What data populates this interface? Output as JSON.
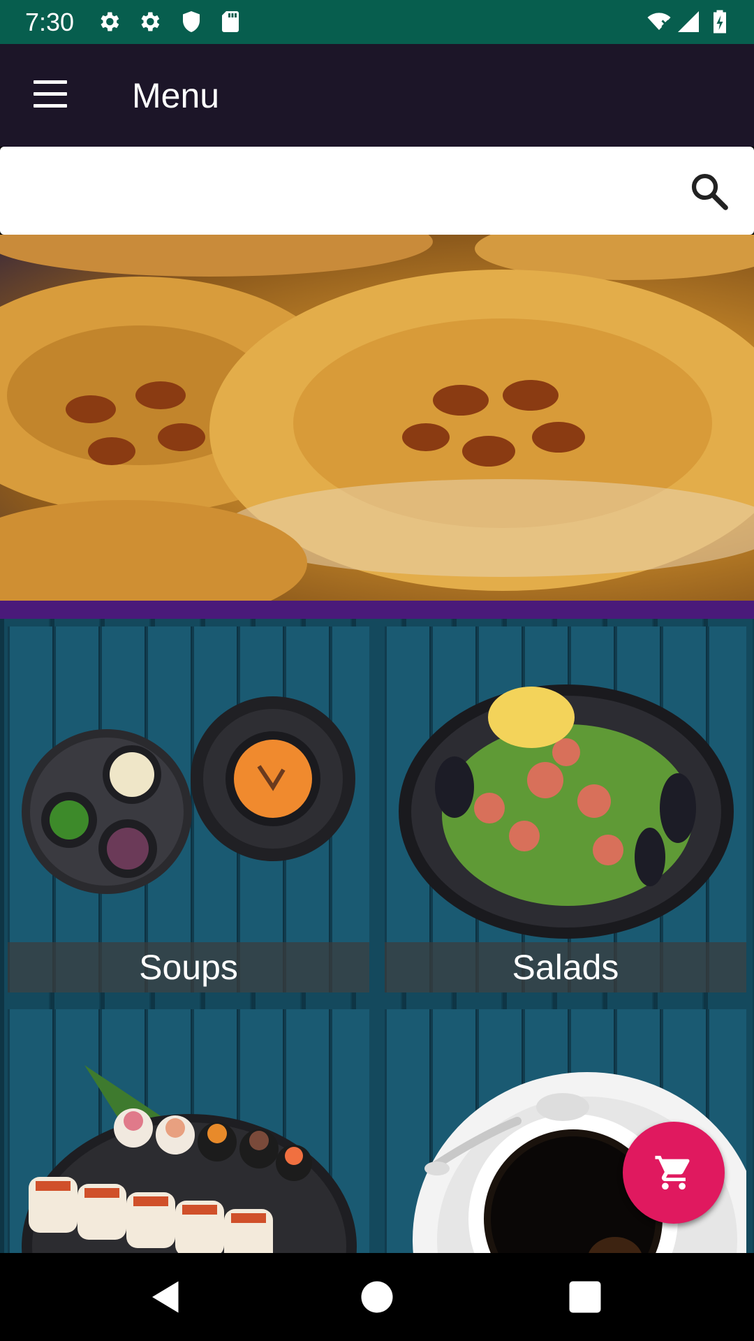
{
  "status_bar": {
    "time": "7:30",
    "left_icons": [
      "settings-icon",
      "settings-icon",
      "shield-icon",
      "sd-card-icon"
    ],
    "right_icons": [
      "wifi-icon",
      "signal-icon",
      "battery-icon"
    ]
  },
  "app_bar": {
    "title": "Menu",
    "menu_icon": "hamburger-menu-icon"
  },
  "search": {
    "placeholder": "",
    "value": "",
    "icon": "search-icon"
  },
  "categories": [
    {
      "label": "Soups"
    },
    {
      "label": "Salads"
    },
    {
      "label": ""
    },
    {
      "label": ""
    }
  ],
  "fab": {
    "icon": "shopping-cart-icon",
    "color": "#e0195f"
  },
  "nav": {
    "back": "back-icon",
    "home": "home-icon",
    "recents": "recents-icon"
  },
  "colors": {
    "status_bar": "#075e4e",
    "app_bar": "#1c1528",
    "accent_strip": "#4a1a7a"
  }
}
